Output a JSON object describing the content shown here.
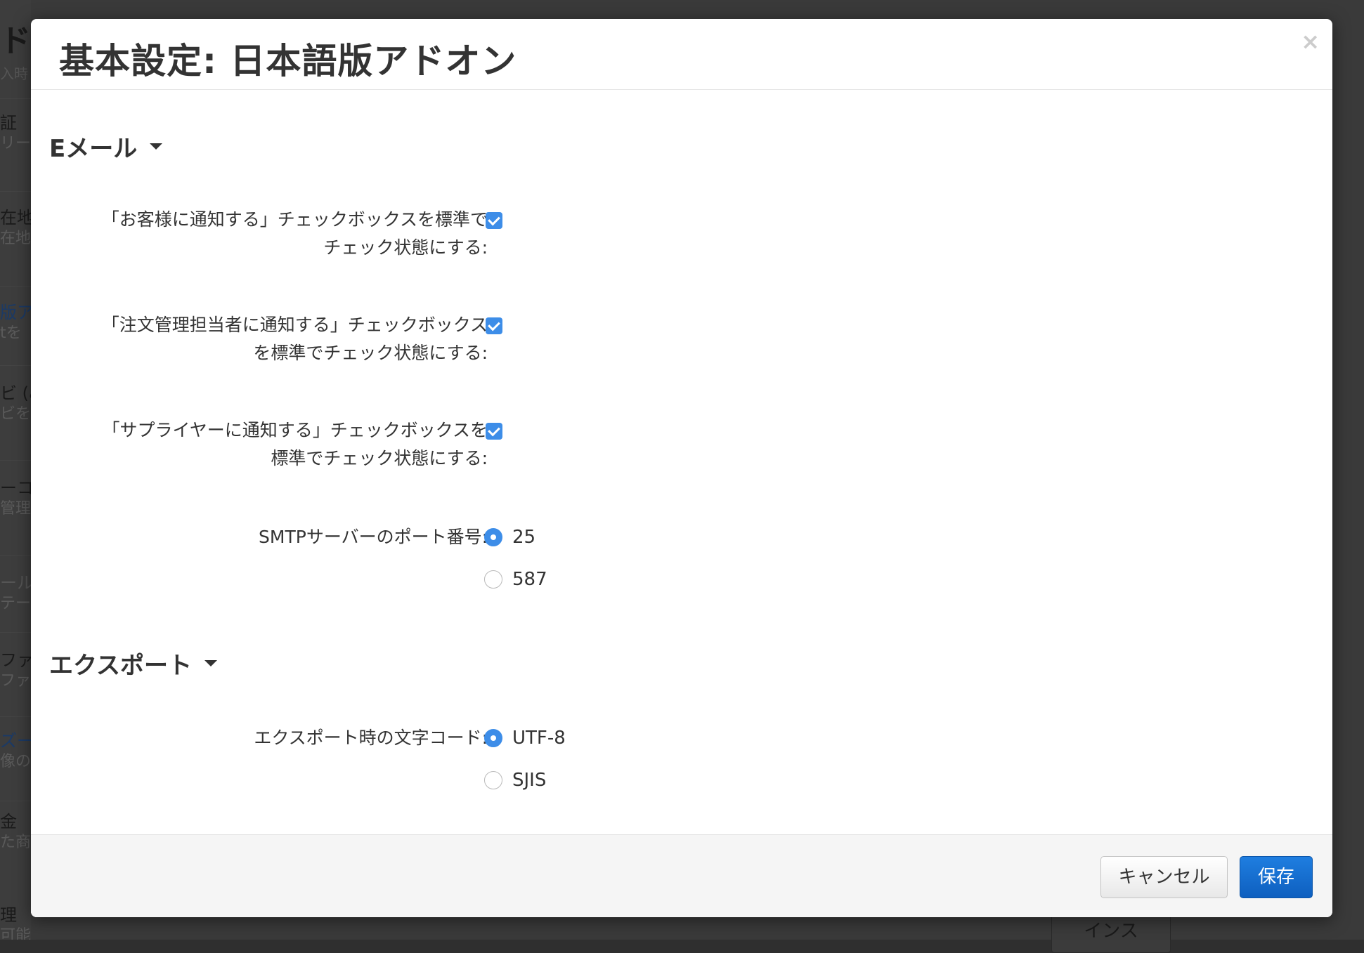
{
  "background": {
    "page_title": "ドン",
    "items": [
      {
        "title": "証",
        "subtitle": "リー"
      },
      {
        "title": "在地",
        "subtitle": "在地"
      },
      {
        "title": "版ア",
        "subtitle": "tを"
      },
      {
        "title": "ビ (み",
        "subtitle": "ビを"
      },
      {
        "title": "ーコ",
        "subtitle": "管理"
      },
      {
        "title": "ール",
        "subtitle": "テー"
      },
      {
        "title": "ファイ",
        "subtitle": "ファ"
      },
      {
        "title": "ズー",
        "subtitle": "像の"
      },
      {
        "title": "金",
        "subtitle": "た商"
      },
      {
        "title": "理",
        "subtitle": "可能にします"
      }
    ],
    "top_caption": "入時",
    "bottom_button": "インス"
  },
  "modal": {
    "title": "基本設定: 日本語版アドオン",
    "close_label": "×",
    "sections": {
      "email": {
        "title": "Eメール",
        "checkbox_1": {
          "line1": "「お客様に通知する」チェックボックスを標準で",
          "line2": "チェック状態にする:",
          "checked": true
        },
        "checkbox_2": {
          "line1": "「注文管理担当者に通知する」チェックボックス",
          "line2": "を標準でチェック状態にする:",
          "checked": true
        },
        "checkbox_3": {
          "line1": "「サプライヤーに通知する」チェックボックスを",
          "line2": "標準でチェック状態にする:",
          "checked": true
        },
        "smtp_port": {
          "label": "SMTPサーバーのポート番号:",
          "options": [
            "25",
            "587"
          ],
          "selected": "25"
        }
      },
      "export": {
        "title": "エクスポート",
        "encoding": {
          "label": "エクスポート時の文字コード:",
          "options": [
            "UTF-8",
            "SJIS"
          ],
          "selected": "UTF-8"
        }
      }
    },
    "footer": {
      "cancel_label": "キャンセル",
      "save_label": "保存"
    }
  },
  "colors": {
    "accent": "#3d8de8",
    "primary_button": "#1466cc"
  }
}
